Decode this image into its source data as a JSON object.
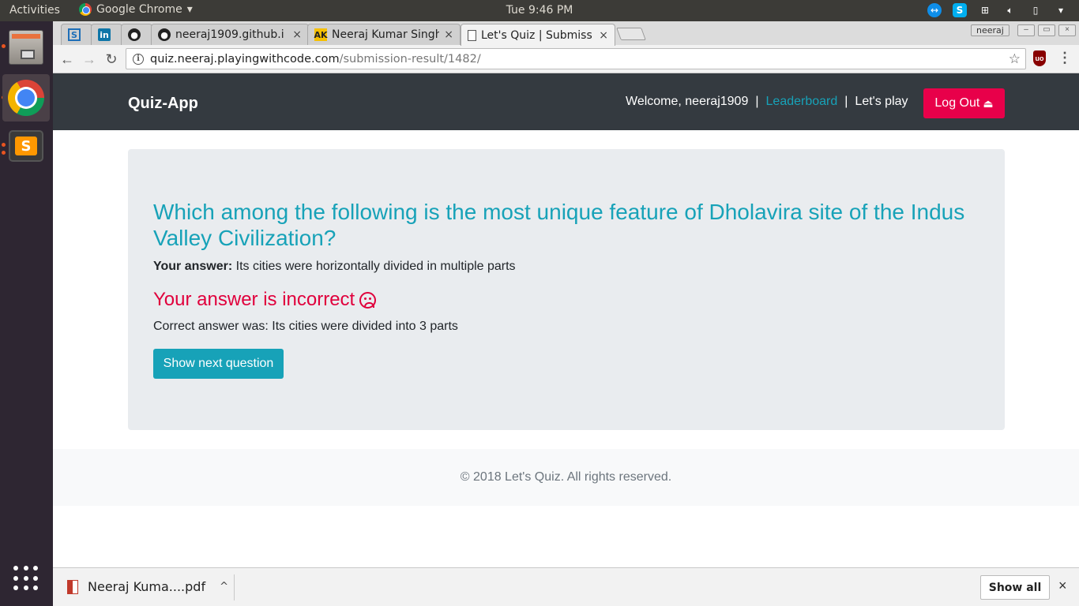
{
  "desktop": {
    "activities_label": "Activities",
    "app_menu_label": "Google Chrome",
    "app_menu_arrow": "▾",
    "clock": "Tue  9:46 PM",
    "tray_icons": [
      "teamviewer-icon",
      "skype-icon",
      "network-icon",
      "volume-icon",
      "battery-icon"
    ],
    "tray_arrow": "▾"
  },
  "dock": {
    "items": [
      "files-icon",
      "chrome-icon",
      "sublime-text-icon"
    ],
    "sublime_glyph": "S",
    "accent_color": "#e95420"
  },
  "browser": {
    "tabs": [
      {
        "title": "",
        "favicon": "S",
        "icon_name": "s-app-icon"
      },
      {
        "title": "",
        "favicon": "in",
        "icon_name": "linkedin-icon"
      },
      {
        "title": "",
        "favicon": "●",
        "icon_name": "github-icon"
      },
      {
        "title": "neeraj1909.github.i",
        "favicon": "●",
        "icon_name": "github-icon"
      },
      {
        "title": "Neeraj Kumar Singh",
        "favicon": "AK",
        "icon_name": "ak-logo-icon"
      },
      {
        "title": "Let's Quiz | Submiss",
        "favicon": "",
        "icon_name": "document-icon"
      }
    ],
    "tab_close": "×",
    "profile_name": "neeraj",
    "window_buttons": [
      "–",
      "▭",
      "×"
    ],
    "nav": {
      "back": "←",
      "forward": "→",
      "reload": "↻"
    },
    "url_host": "quiz.neeraj.playingwithcode.com",
    "url_path": "/submission-result/1482/",
    "info_glyph": "i",
    "star_glyph": "☆",
    "ublock_glyph": "uo",
    "menu_glyph": "⋮"
  },
  "site": {
    "brand": "Quiz-App",
    "welcome": "Welcome, neeraj1909",
    "separator": "|",
    "leaderboard": "Leaderboard",
    "lets_play": "Let's play",
    "logout": "Log Out",
    "logout_icon": "⏏",
    "brand_color": "#343a40",
    "accent_color": "#17a2b8",
    "danger_color": "#e8004a"
  },
  "result": {
    "question": "Which among the following is the most unique feature of Dholavira site of the Indus Valley Civilization?",
    "your_answer_label": "Your answer:",
    "your_answer": "Its cities were horizontally divided in multiple parts",
    "verdict": "Your answer is incorrect",
    "correct_answer": "Correct answer was: Its cities were divided into 3 parts",
    "next_button": "Show next question"
  },
  "footer": {
    "text": "© 2018 Let's Quiz.  All rights reserved."
  },
  "downloads": {
    "file_name": "Neeraj Kuma....pdf",
    "chevron": "^",
    "show_all": "Show all",
    "close": "×"
  }
}
